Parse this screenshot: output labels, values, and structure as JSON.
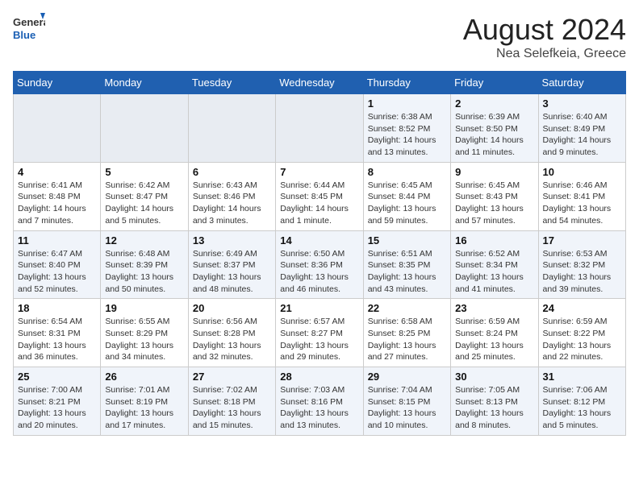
{
  "logo": {
    "line1": "General",
    "line2": "Blue"
  },
  "title": "August 2024",
  "subtitle": "Nea Selefkeia, Greece",
  "days_of_week": [
    "Sunday",
    "Monday",
    "Tuesday",
    "Wednesday",
    "Thursday",
    "Friday",
    "Saturday"
  ],
  "weeks": [
    [
      {
        "day": "",
        "info": ""
      },
      {
        "day": "",
        "info": ""
      },
      {
        "day": "",
        "info": ""
      },
      {
        "day": "",
        "info": ""
      },
      {
        "day": "1",
        "info": "Sunrise: 6:38 AM\nSunset: 8:52 PM\nDaylight: 14 hours and 13 minutes."
      },
      {
        "day": "2",
        "info": "Sunrise: 6:39 AM\nSunset: 8:50 PM\nDaylight: 14 hours and 11 minutes."
      },
      {
        "day": "3",
        "info": "Sunrise: 6:40 AM\nSunset: 8:49 PM\nDaylight: 14 hours and 9 minutes."
      }
    ],
    [
      {
        "day": "4",
        "info": "Sunrise: 6:41 AM\nSunset: 8:48 PM\nDaylight: 14 hours and 7 minutes."
      },
      {
        "day": "5",
        "info": "Sunrise: 6:42 AM\nSunset: 8:47 PM\nDaylight: 14 hours and 5 minutes."
      },
      {
        "day": "6",
        "info": "Sunrise: 6:43 AM\nSunset: 8:46 PM\nDaylight: 14 hours and 3 minutes."
      },
      {
        "day": "7",
        "info": "Sunrise: 6:44 AM\nSunset: 8:45 PM\nDaylight: 14 hours and 1 minute."
      },
      {
        "day": "8",
        "info": "Sunrise: 6:45 AM\nSunset: 8:44 PM\nDaylight: 13 hours and 59 minutes."
      },
      {
        "day": "9",
        "info": "Sunrise: 6:45 AM\nSunset: 8:43 PM\nDaylight: 13 hours and 57 minutes."
      },
      {
        "day": "10",
        "info": "Sunrise: 6:46 AM\nSunset: 8:41 PM\nDaylight: 13 hours and 54 minutes."
      }
    ],
    [
      {
        "day": "11",
        "info": "Sunrise: 6:47 AM\nSunset: 8:40 PM\nDaylight: 13 hours and 52 minutes."
      },
      {
        "day": "12",
        "info": "Sunrise: 6:48 AM\nSunset: 8:39 PM\nDaylight: 13 hours and 50 minutes."
      },
      {
        "day": "13",
        "info": "Sunrise: 6:49 AM\nSunset: 8:37 PM\nDaylight: 13 hours and 48 minutes."
      },
      {
        "day": "14",
        "info": "Sunrise: 6:50 AM\nSunset: 8:36 PM\nDaylight: 13 hours and 46 minutes."
      },
      {
        "day": "15",
        "info": "Sunrise: 6:51 AM\nSunset: 8:35 PM\nDaylight: 13 hours and 43 minutes."
      },
      {
        "day": "16",
        "info": "Sunrise: 6:52 AM\nSunset: 8:34 PM\nDaylight: 13 hours and 41 minutes."
      },
      {
        "day": "17",
        "info": "Sunrise: 6:53 AM\nSunset: 8:32 PM\nDaylight: 13 hours and 39 minutes."
      }
    ],
    [
      {
        "day": "18",
        "info": "Sunrise: 6:54 AM\nSunset: 8:31 PM\nDaylight: 13 hours and 36 minutes."
      },
      {
        "day": "19",
        "info": "Sunrise: 6:55 AM\nSunset: 8:29 PM\nDaylight: 13 hours and 34 minutes."
      },
      {
        "day": "20",
        "info": "Sunrise: 6:56 AM\nSunset: 8:28 PM\nDaylight: 13 hours and 32 minutes."
      },
      {
        "day": "21",
        "info": "Sunrise: 6:57 AM\nSunset: 8:27 PM\nDaylight: 13 hours and 29 minutes."
      },
      {
        "day": "22",
        "info": "Sunrise: 6:58 AM\nSunset: 8:25 PM\nDaylight: 13 hours and 27 minutes."
      },
      {
        "day": "23",
        "info": "Sunrise: 6:59 AM\nSunset: 8:24 PM\nDaylight: 13 hours and 25 minutes."
      },
      {
        "day": "24",
        "info": "Sunrise: 6:59 AM\nSunset: 8:22 PM\nDaylight: 13 hours and 22 minutes."
      }
    ],
    [
      {
        "day": "25",
        "info": "Sunrise: 7:00 AM\nSunset: 8:21 PM\nDaylight: 13 hours and 20 minutes."
      },
      {
        "day": "26",
        "info": "Sunrise: 7:01 AM\nSunset: 8:19 PM\nDaylight: 13 hours and 17 minutes."
      },
      {
        "day": "27",
        "info": "Sunrise: 7:02 AM\nSunset: 8:18 PM\nDaylight: 13 hours and 15 minutes."
      },
      {
        "day": "28",
        "info": "Sunrise: 7:03 AM\nSunset: 8:16 PM\nDaylight: 13 hours and 13 minutes."
      },
      {
        "day": "29",
        "info": "Sunrise: 7:04 AM\nSunset: 8:15 PM\nDaylight: 13 hours and 10 minutes."
      },
      {
        "day": "30",
        "info": "Sunrise: 7:05 AM\nSunset: 8:13 PM\nDaylight: 13 hours and 8 minutes."
      },
      {
        "day": "31",
        "info": "Sunrise: 7:06 AM\nSunset: 8:12 PM\nDaylight: 13 hours and 5 minutes."
      }
    ]
  ]
}
